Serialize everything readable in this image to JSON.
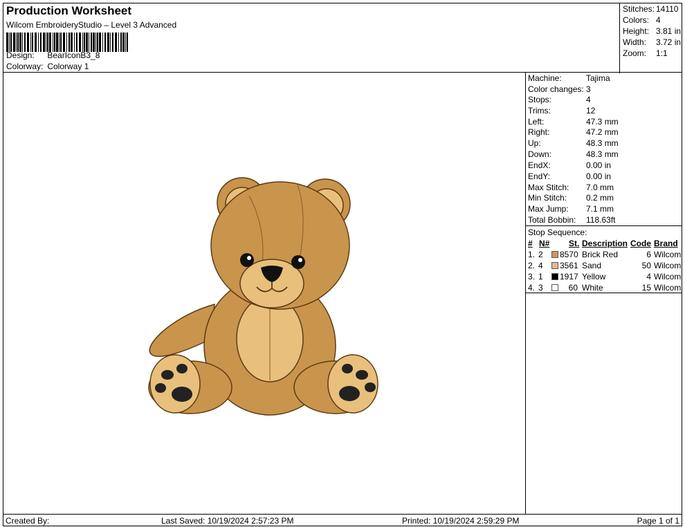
{
  "header": {
    "title": "Production Worksheet",
    "subtitle": "Wilcom EmbroideryStudio – Level 3 Advanced",
    "design_label": "Design:",
    "design_value": "BearIconB3_8",
    "colorway_label": "Colorway:",
    "colorway_value": "Colorway 1"
  },
  "stats": [
    {
      "label": "Stitches:",
      "value": "14110"
    },
    {
      "label": "Colors:",
      "value": "4"
    },
    {
      "label": "Height:",
      "value": "3.81 in"
    },
    {
      "label": "Width:",
      "value": "3.72 in"
    },
    {
      "label": "Zoom:",
      "value": "1:1"
    }
  ],
  "properties": [
    {
      "label": "Machine:",
      "value": "Tajima"
    },
    {
      "label": "Color changes:",
      "value": "3"
    },
    {
      "label": "Stops:",
      "value": "4"
    },
    {
      "label": "Trims:",
      "value": "12"
    },
    {
      "label": "Left:",
      "value": "47.3 mm"
    },
    {
      "label": "Right:",
      "value": "47.2 mm"
    },
    {
      "label": "Up:",
      "value": "48.3 mm"
    },
    {
      "label": "Down:",
      "value": "48.3 mm"
    },
    {
      "label": "EndX:",
      "value": "0.00 in"
    },
    {
      "label": "EndY:",
      "value": "0.00 in"
    },
    {
      "label": "Max Stitch:",
      "value": "7.0 mm"
    },
    {
      "label": "Min Stitch:",
      "value": "0.2 mm"
    },
    {
      "label": "Max Jump:",
      "value": "7.1 mm"
    },
    {
      "label": "Total Bobbin:",
      "value": "118.63ft"
    }
  ],
  "stop_sequence": {
    "label": "Stop Sequence:",
    "headers": {
      "num": "#",
      "n": "N#",
      "st": "St.",
      "description": "Description",
      "code": "Code",
      "brand": "Brand"
    },
    "rows": [
      {
        "num": "1.",
        "n": "2",
        "swatch": "#d9915e",
        "st": "8570",
        "description": "Brick Red",
        "code": "6",
        "brand": "Wilcom"
      },
      {
        "num": "2.",
        "n": "4",
        "swatch": "#f0b48a",
        "st": "3561",
        "description": "Sand",
        "code": "50",
        "brand": "Wilcom"
      },
      {
        "num": "3.",
        "n": "1",
        "swatch": "#000000",
        "st": "1917",
        "description": "Yellow",
        "code": "4",
        "brand": "Wilcom"
      },
      {
        "num": "4.",
        "n": "3",
        "swatch": "#ffffff",
        "st": "60",
        "description": "White",
        "code": "15",
        "brand": "Wilcom"
      }
    ]
  },
  "footer": {
    "created_by": "Created By:",
    "last_saved": "Last Saved: 10/19/2024 2:57:23 PM",
    "printed": "Printed: 10/19/2024 2:59:29 PM",
    "page": "Page 1 of 1"
  },
  "colors": {
    "bear_main": "#c9944c",
    "bear_light": "#e8c07c",
    "bear_dark": "#7a4f1d",
    "paw": "#222222"
  }
}
